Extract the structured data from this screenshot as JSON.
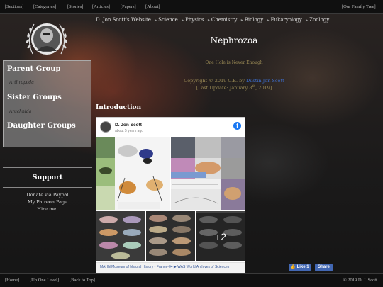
{
  "topnav": {
    "sections": "[Sections]",
    "categories": "[Categories]",
    "stories": "[Stories]",
    "articles": "[Articles]",
    "papers": "[Papers]",
    "about": "[About]",
    "family_tree": "[Our Family Tree]"
  },
  "sidebar": {
    "parent_heading": "Parent Group",
    "parent_item": "Arthropoda",
    "sister_heading": "Sister Groups",
    "sister_item": "Arachnida",
    "daughter_heading": "Daughter Groups",
    "support_title": "Support",
    "support_links": [
      "Donate via Paypal",
      "My Patreon Page",
      "Hire me!"
    ]
  },
  "breadcrumb": [
    "D. Jon Scott's Website",
    "Science",
    "Physics",
    "Chemistry",
    "Biology",
    "Eukaryology",
    "Zoology"
  ],
  "page": {
    "title": "Nephrozoa",
    "motto": "One Hole is Never Enough",
    "copyright_prefix": "Copyright © 2019 C.E. by",
    "author": "Dustin Jon Scott",
    "last_update_prefix": "[Last Update: January 8",
    "last_update_sup": "th",
    "last_update_suffix": ", 2019]",
    "intro_heading": "Introduction"
  },
  "post": {
    "author": "D. Jon Scott",
    "time": "about 5 years ago",
    "more_count": "+2",
    "caption": "MAHN Museum of Natural History - France-04 ▶ WAS World Archives of Sciences"
  },
  "bottomnav": {
    "home": "[Home]",
    "up": "[Up One Level]",
    "top": "[Back to Top]",
    "like": "Like 1",
    "share": "Share",
    "copyright": "© 2019 D. J. Scott"
  },
  "colors": {
    "link_blue": "#3d6fd0",
    "muted_gold": "#9a8a55",
    "facebook_blue": "#4267b2"
  }
}
